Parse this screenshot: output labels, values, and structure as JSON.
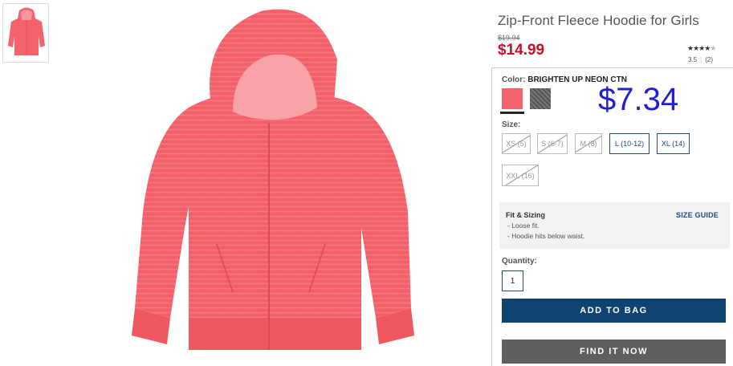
{
  "product": {
    "title": "Zip-Front Fleece Hoodie for Girls",
    "original_price": "$19.94",
    "sale_price": "$14.99",
    "rating_value": "3.5",
    "review_count": "(2)",
    "rating_stars": 3.5
  },
  "overlay": {
    "price": "$7.34",
    "color": "#1f1fd6"
  },
  "color": {
    "label": "Color:",
    "selected": "BRIGHTEN UP NEON CTN",
    "swatches": [
      "coral",
      "charcoal"
    ]
  },
  "size": {
    "label": "Size:",
    "options": [
      {
        "label": "XS (5)",
        "available": false
      },
      {
        "label": "S (6-7)",
        "available": false
      },
      {
        "label": "M (8)",
        "available": false
      },
      {
        "label": "L (10-12)",
        "available": true
      },
      {
        "label": "XL (14)",
        "available": true
      },
      {
        "label": "XXL (16)",
        "available": false
      }
    ]
  },
  "fit": {
    "title": "Fit & Sizing",
    "lines": [
      "- Loose fit.",
      "- Hoodie hits below waist."
    ],
    "size_guide": "SIZE GUIDE"
  },
  "quantity": {
    "label": "Quantity:",
    "value": "1"
  },
  "actions": {
    "add_to_bag": "ADD TO BAG",
    "find_it_now": "FIND IT NOW"
  },
  "colors": {
    "sale": "#c8102e",
    "primary_button": "#0f4372",
    "secondary_button": "#5f5f5f",
    "hoodie": "#f4636b"
  }
}
